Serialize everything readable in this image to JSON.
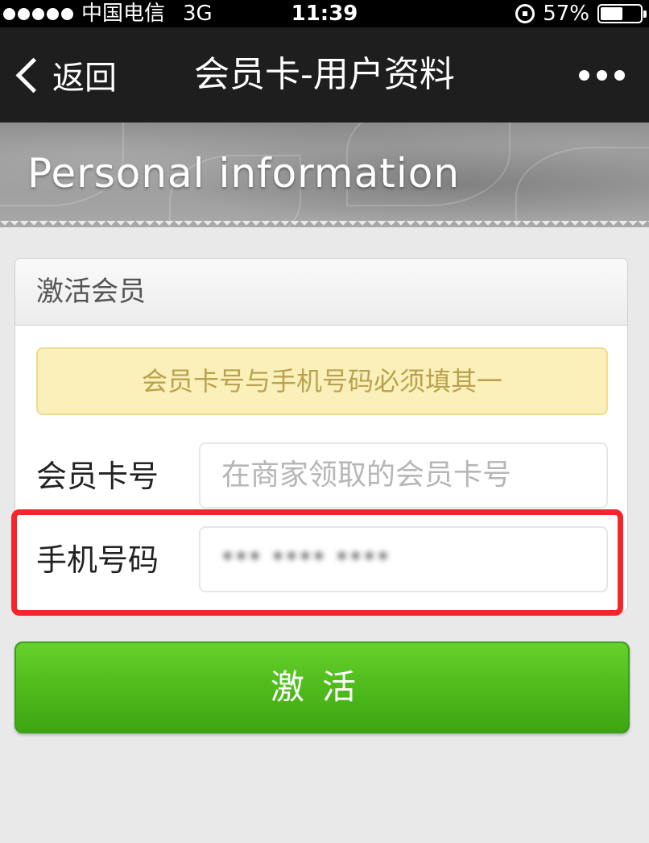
{
  "status_bar": {
    "carrier": "中国电信",
    "network": "3G",
    "time": "11:39",
    "battery": "57%",
    "battery_level": 0.57
  },
  "nav": {
    "back_label": "返回",
    "title": "会员卡-用户资料"
  },
  "banner": {
    "title": "Personal information"
  },
  "form": {
    "header": "激活会员",
    "notice": "会员卡号与手机号码必须填其一",
    "card_number": {
      "label": "会员卡号",
      "placeholder": "在商家领取的会员卡号",
      "value": ""
    },
    "phone": {
      "label": "手机号码",
      "value_display": "*** **** ****",
      "blurred": true
    }
  },
  "activate_button": {
    "label": "激活"
  },
  "colors": {
    "nav_bg": "#1e1e1e",
    "notice_bg": "#fbf0b9",
    "notice_text": "#b9a24e",
    "button_green": "#4fbb1c",
    "highlight_red": "#f4262a"
  }
}
